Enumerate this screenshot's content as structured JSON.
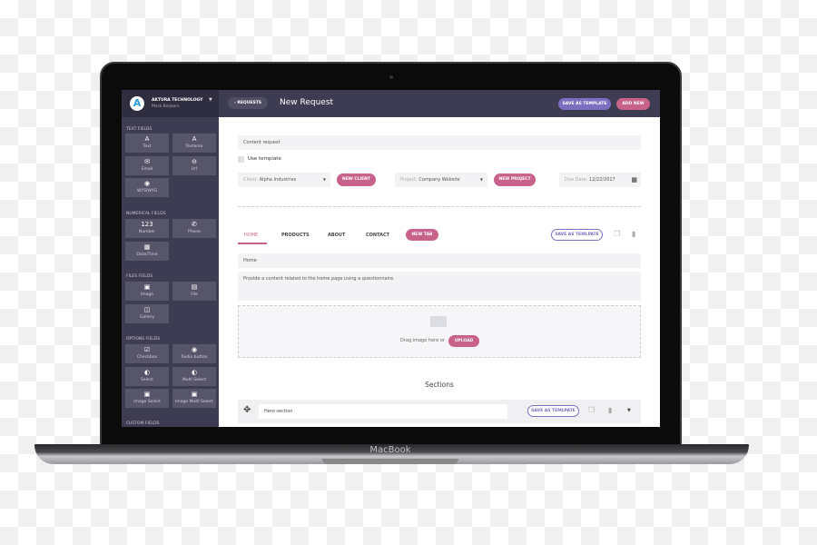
{
  "device": {
    "brand": "MacBook"
  },
  "sidebar": {
    "company": "AKTURA TECHNOLOGY",
    "user": "Mark Beljaars",
    "logo_letter": "A",
    "sections": [
      {
        "title": "TEXT FIELDS",
        "items": [
          {
            "label": "Text",
            "icon": "A"
          },
          {
            "label": "Textarea",
            "icon": "A"
          },
          {
            "label": "Email",
            "icon": "✉"
          },
          {
            "label": "Url",
            "icon": "⊖"
          },
          {
            "label": "WYSIWYG",
            "icon": "◉"
          }
        ]
      },
      {
        "title": "NUMERICAL FIELDS",
        "items": [
          {
            "label": "Number",
            "icon": "123"
          },
          {
            "label": "Phone",
            "icon": "✆"
          },
          {
            "label": "Date/Time",
            "icon": "▦"
          }
        ]
      },
      {
        "title": "FILES FIELDS",
        "items": [
          {
            "label": "Image",
            "icon": "▣"
          },
          {
            "label": "File",
            "icon": "▤"
          },
          {
            "label": "Gallery",
            "icon": "◫"
          }
        ]
      },
      {
        "title": "OPTIONS FIELDS",
        "items": [
          {
            "label": "Checkbox",
            "icon": "☑"
          },
          {
            "label": "Radio button",
            "icon": "◉"
          },
          {
            "label": "Select",
            "icon": "◐"
          },
          {
            "label": "Multi Select",
            "icon": "◐"
          },
          {
            "label": "Image Select",
            "icon": "▣"
          },
          {
            "label": "Image Multi Select",
            "icon": "▣"
          }
        ]
      },
      {
        "title": "CUSTOM FIELDS",
        "items": []
      }
    ]
  },
  "header": {
    "back_label": "REQUESTS",
    "title": "New Request",
    "save_template": "SAVE AS TEMPLATE",
    "add_new": "ADD NEW"
  },
  "form": {
    "name_value": "Content request",
    "use_template": "Use template",
    "client_label": "Client:",
    "client_value": "Alpha Industries",
    "new_client": "NEW CLIENT",
    "project_label": "Project:",
    "project_value": "Company Website",
    "new_project": "NEW PROJECT",
    "due_label": "Due Date:",
    "due_value": "12/22/2017"
  },
  "tabs": {
    "items": [
      "HOME",
      "PRODUCTS",
      "ABOUT",
      "CONTACT"
    ],
    "active": "HOME",
    "new_tab": "NEW TAB",
    "save_template": "SAVE AS TEMLPATE"
  },
  "page": {
    "title_value": "Home",
    "description": "Provide a content related to the home page using a questionnaire.",
    "drag_text": "Drag image here or",
    "upload": "UPLOAD"
  },
  "sections": {
    "heading": "Sections",
    "items": [
      {
        "name": "Hero section",
        "save_template": "SAVE AS TEMLPATE"
      }
    ]
  },
  "colors": {
    "accent_pink": "#c9628a",
    "accent_purple": "#7b6fc0",
    "sidebar": "#3e3c52"
  }
}
